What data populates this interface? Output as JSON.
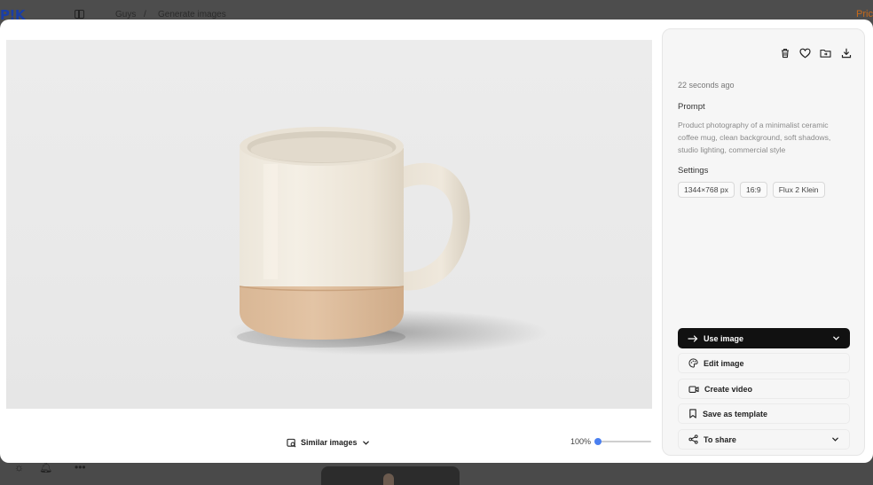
{
  "background": {
    "logo": "P!K",
    "breadcrumb": [
      "Guys",
      "Generate images"
    ],
    "breadcrumb_separator": "/",
    "pricing_label": "Pric"
  },
  "viewer": {
    "image_icon": "mug-photo",
    "similar_label": "Similar images",
    "zoom_label": "100%",
    "zoom_level": 0
  },
  "panel": {
    "timestamp": "22 seconds ago",
    "prompt_title": "Prompt",
    "prompt_text": "Product photography of a minimalist ceramic coffee mug, clean background, soft shadows, studio lighting, commercial style",
    "settings_title": "Settings",
    "settings_tags": [
      "1344×768 px",
      "16:9",
      "Flux 2 Klein"
    ],
    "actions": {
      "use_image": "Use image",
      "edit_image": "Edit image",
      "create_video": "Create video",
      "save_template": "Save as template",
      "share": "To share"
    }
  },
  "icons": {
    "top_actions": [
      "trash-icon",
      "heart-icon",
      "folder-icon",
      "download-icon"
    ],
    "accent": "#4a7ff0"
  }
}
